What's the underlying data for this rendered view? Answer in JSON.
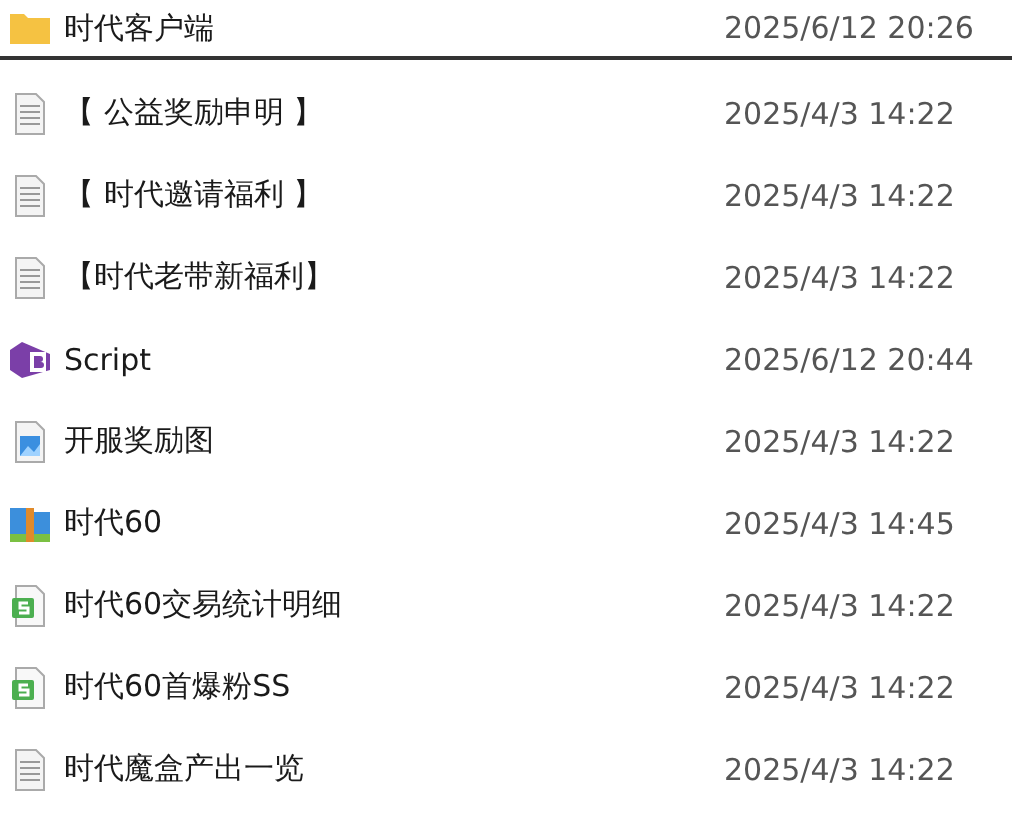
{
  "files": [
    {
      "name": "时代客户端",
      "date": "2025/6/12 20:26",
      "kind": "folder"
    },
    {
      "name": "【 公益奖励申明 】",
      "date": "2025/4/3 14:22",
      "kind": "text"
    },
    {
      "name": "【 时代邀请福利 】",
      "date": "2025/4/3 14:22",
      "kind": "text"
    },
    {
      "name": "【时代老带新福利】",
      "date": "2025/4/3 14:22",
      "kind": "text"
    },
    {
      "name": "Script",
      "date": "2025/6/12 20:44",
      "kind": "script"
    },
    {
      "name": "开服奖励图",
      "date": "2025/4/3 14:22",
      "kind": "image"
    },
    {
      "name": "时代60",
      "date": "2025/4/3 14:45",
      "kind": "archive"
    },
    {
      "name": "时代60交易统计明细",
      "date": "2025/4/3 14:22",
      "kind": "sheet"
    },
    {
      "name": "时代60首爆粉SS",
      "date": "2025/4/3 14:22",
      "kind": "sheet"
    },
    {
      "name": "时代魔盒产出一览",
      "date": "2025/4/3 14:22",
      "kind": "text"
    }
  ]
}
